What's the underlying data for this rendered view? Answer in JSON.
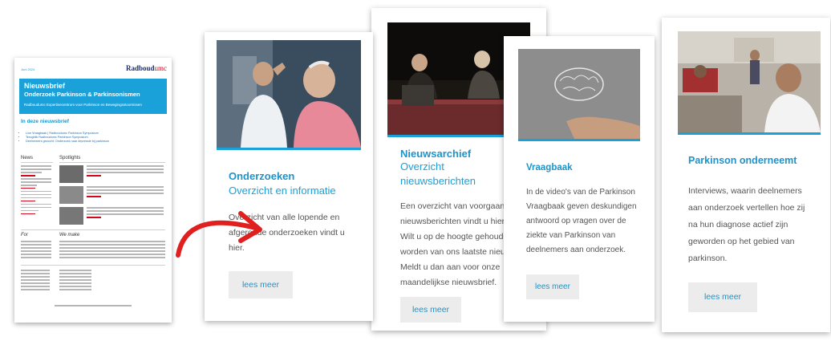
{
  "newsletter": {
    "date": "Juni 2024",
    "brand": "Radboud",
    "brand_suffix": "umc",
    "title": "Nieuwsbrief",
    "subtitle": "Onderzoek Parkinson & Parkinsonismen",
    "tagline": "Radboudumc Expertisecentrum voor Parkinson en Bewegingsstoornissen",
    "section_title": "In deze nieuwsbrief",
    "items": [
      "Live Vraagbaak | Radboudumc Parkinson Symposium",
      "Terugblik Radboudumc Parkinson Symposium",
      "Deelnemers gezocht: Onderzoek naar depressie bij parkinson"
    ],
    "news_heading": "News",
    "spotlights_heading": "Spotlights",
    "for_heading": "For",
    "we_make_heading": "We make"
  },
  "cards": [
    {
      "title": "Onderzoeken",
      "subtitle": "Overzicht en informatie",
      "body": [
        "Overzicht van alle lopende en",
        "afgeronde onderzoeken vindt u",
        "hier."
      ],
      "button": "lees meer"
    },
    {
      "title": "Nieuwsarchief",
      "subtitle": [
        "Overzicht",
        "nieuwsberichten"
      ],
      "body": [
        "Een overzicht van voorgaande",
        "nieuwsberichten vindt u hier.",
        "Wilt u op de hoogte gehouden",
        "worden van ons laatste nieuws?",
        "Meldt u dan aan voor onze",
        "maandelijkse nieuwsbrief."
      ],
      "button": "lees meer"
    },
    {
      "title": "Vraagbaak",
      "body": [
        "In de video's van de Parkinson",
        "Vraagbaak geven deskundigen",
        "antwoord op vragen over de",
        "ziekte van Parkinson van",
        "deelnemers aan onderzoek."
      ],
      "button": "lees meer"
    },
    {
      "title": "Parkinson onderneemt",
      "body": [
        "Interviews, waarin deelnemers",
        "aan onderzoek vertellen hoe zij",
        "na hun diagnose actief zijn",
        "geworden op het gebied van",
        "parkinson."
      ],
      "button": "lees meer"
    }
  ],
  "colors": {
    "accent": "#1ba1d9",
    "title": "#1f93c7",
    "arrow": "#e0201f",
    "button_bg": "#ececec"
  }
}
